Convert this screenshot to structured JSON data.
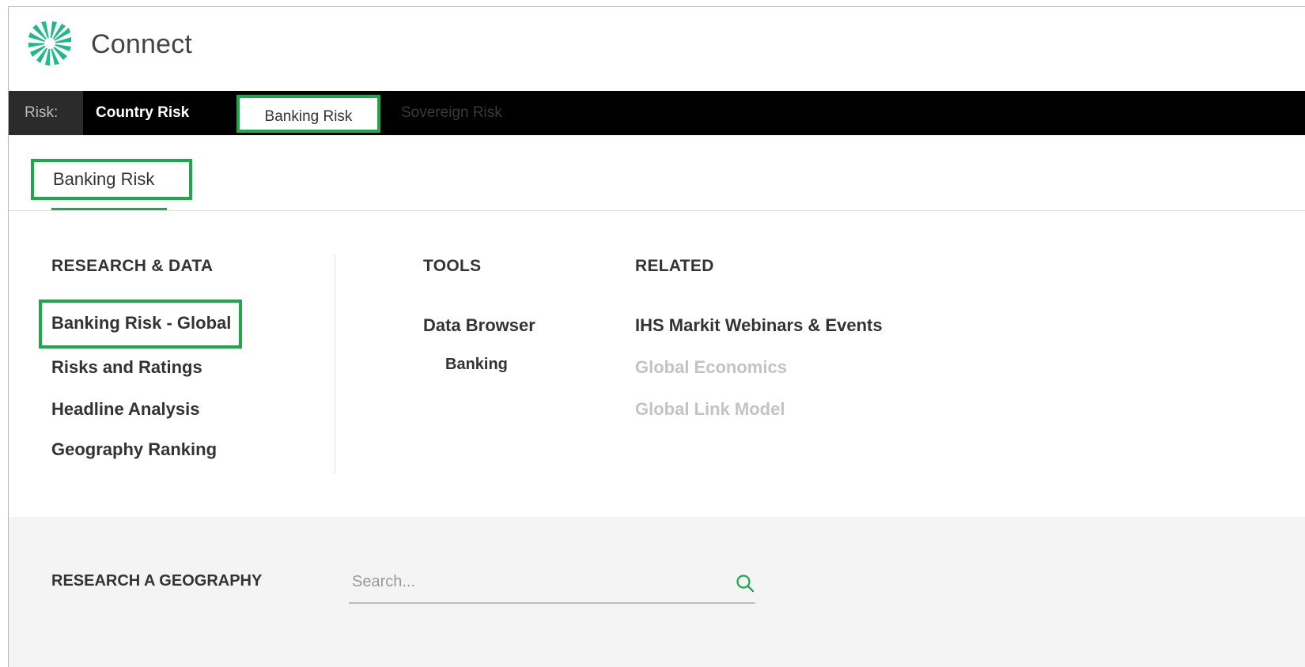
{
  "app": {
    "title": "Connect"
  },
  "risk_nav": {
    "label": "Risk:",
    "tabs": [
      {
        "label": "Country Risk"
      },
      {
        "label": "Banking Risk",
        "active": true
      },
      {
        "label": "Sovereign Risk"
      }
    ]
  },
  "sub_nav": {
    "active_label": "Banking Risk"
  },
  "menu": {
    "research_data": {
      "heading": "RESEARCH & DATA",
      "items": [
        "Banking Risk - Global",
        "Risks and Ratings",
        "Headline Analysis",
        "Geography Ranking"
      ]
    },
    "tools": {
      "heading": "TOOLS",
      "items": [
        "Data Browser",
        "Banking"
      ]
    },
    "related": {
      "heading": "RELATED",
      "items": [
        "IHS Markit Webinars & Events",
        "Global Economics",
        "Global Link Model"
      ]
    }
  },
  "geography": {
    "label": "RESEARCH A GEOGRAPHY",
    "search_placeholder": "Search..."
  },
  "colors": {
    "accent_green": "#1ea84a",
    "nav_bg": "#000000",
    "band_bg": "#f4f4f4"
  },
  "icons": {
    "logo": "connect-logo-icon",
    "search": "search-icon"
  }
}
